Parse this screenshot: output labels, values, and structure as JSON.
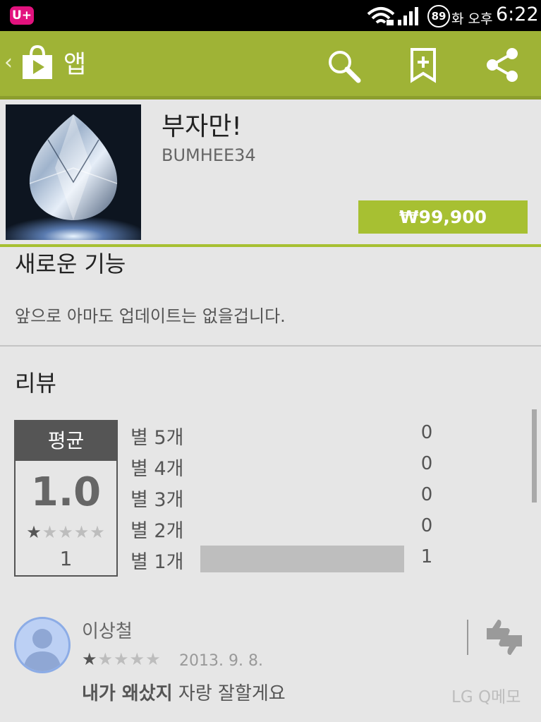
{
  "status_bar": {
    "carrier": "U+",
    "battery": "89",
    "ampm": "화 오후",
    "time": "6:22"
  },
  "action_bar": {
    "title": "앱",
    "color": "#9fb336"
  },
  "app": {
    "title": "부자만!",
    "developer": "BUMHEE34",
    "price": "₩99,900",
    "accent_color": "#a7c032"
  },
  "whats_new": {
    "heading": "새로운 기능",
    "body": "앞으로 아마도 업데이트는 없을겁니다."
  },
  "reviews": {
    "heading": "리뷰",
    "average_label": "평균",
    "average_value": "1.0",
    "average_stars": 1,
    "total_count": "1",
    "histogram": [
      {
        "label": "별 5개",
        "count": "0",
        "fraction": 0
      },
      {
        "label": "별 4개",
        "count": "0",
        "fraction": 0
      },
      {
        "label": "별 3개",
        "count": "0",
        "fraction": 0
      },
      {
        "label": "별 2개",
        "count": "0",
        "fraction": 0
      },
      {
        "label": "별 1개",
        "count": "1",
        "fraction": 1
      }
    ],
    "items": [
      {
        "author": "이상철",
        "stars": 1,
        "date": "2013. 9. 8.",
        "title": "내가 왜샀지",
        "text": " 자랑 잘할게요"
      }
    ]
  },
  "overlay": {
    "memo_label": "LG Q메모"
  }
}
